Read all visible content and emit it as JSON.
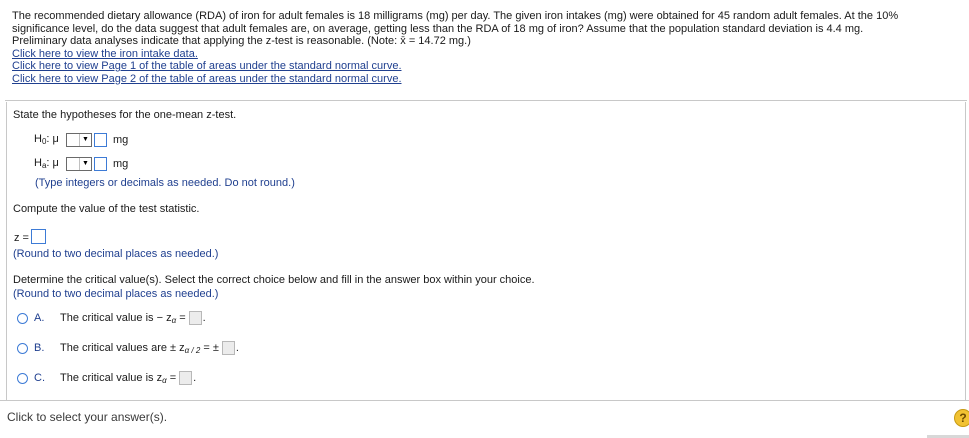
{
  "problem": {
    "line1": "The recommended dietary allowance (RDA) of iron for adult females is 18 milligrams (mg) per day. The given iron intakes (mg) were obtained for 45 random adult females. At the 10%",
    "line2": "significance level, do the data suggest that adult females are, on average, getting less than the RDA of 18 mg of iron? Assume that the population standard deviation is 4.4 mg.",
    "line3": "Preliminary data analyses indicate that applying the z-test is reasonable. (Note: x̄ = 14.72 mg.)",
    "links": [
      "Click here to view the iron intake data.",
      "Click here to view Page 1 of the table of areas under the standard normal curve.",
      "Click here to view Page 2 of the table of areas under the standard normal curve."
    ]
  },
  "hypotheses": {
    "prompt": "State the hypotheses for the one-mean z-test.",
    "h0_symbol": "H",
    "h0_sub": "0",
    "ha_symbol": "H",
    "ha_sub": "a",
    "mu": ": μ",
    "unit": "mg",
    "dropdown_arrow": "▼",
    "hint": "(Type integers or decimals as needed. Do not round.)"
  },
  "statistic": {
    "prompt": "Compute the value of the test statistic.",
    "label": "z =",
    "hint": "(Round to two decimal places as needed.)"
  },
  "critical": {
    "prompt": "Determine the critical value(s). Select the correct choice below and fill in the answer box within your choice.",
    "hint": "(Round to two decimal places as needed.)",
    "choices": [
      {
        "letter": "A.",
        "text": "The critical value is  − z",
        "sub": "α",
        "suffix": " ="
      },
      {
        "letter": "B.",
        "text": "The critical values are  ± z",
        "sub": "α / 2",
        "suffix": " = ±"
      },
      {
        "letter": "C.",
        "text": "The critical value is z",
        "sub": "α",
        "suffix": " ="
      }
    ]
  },
  "footer": {
    "status": "Click to select your answer(s).",
    "help": "?"
  }
}
